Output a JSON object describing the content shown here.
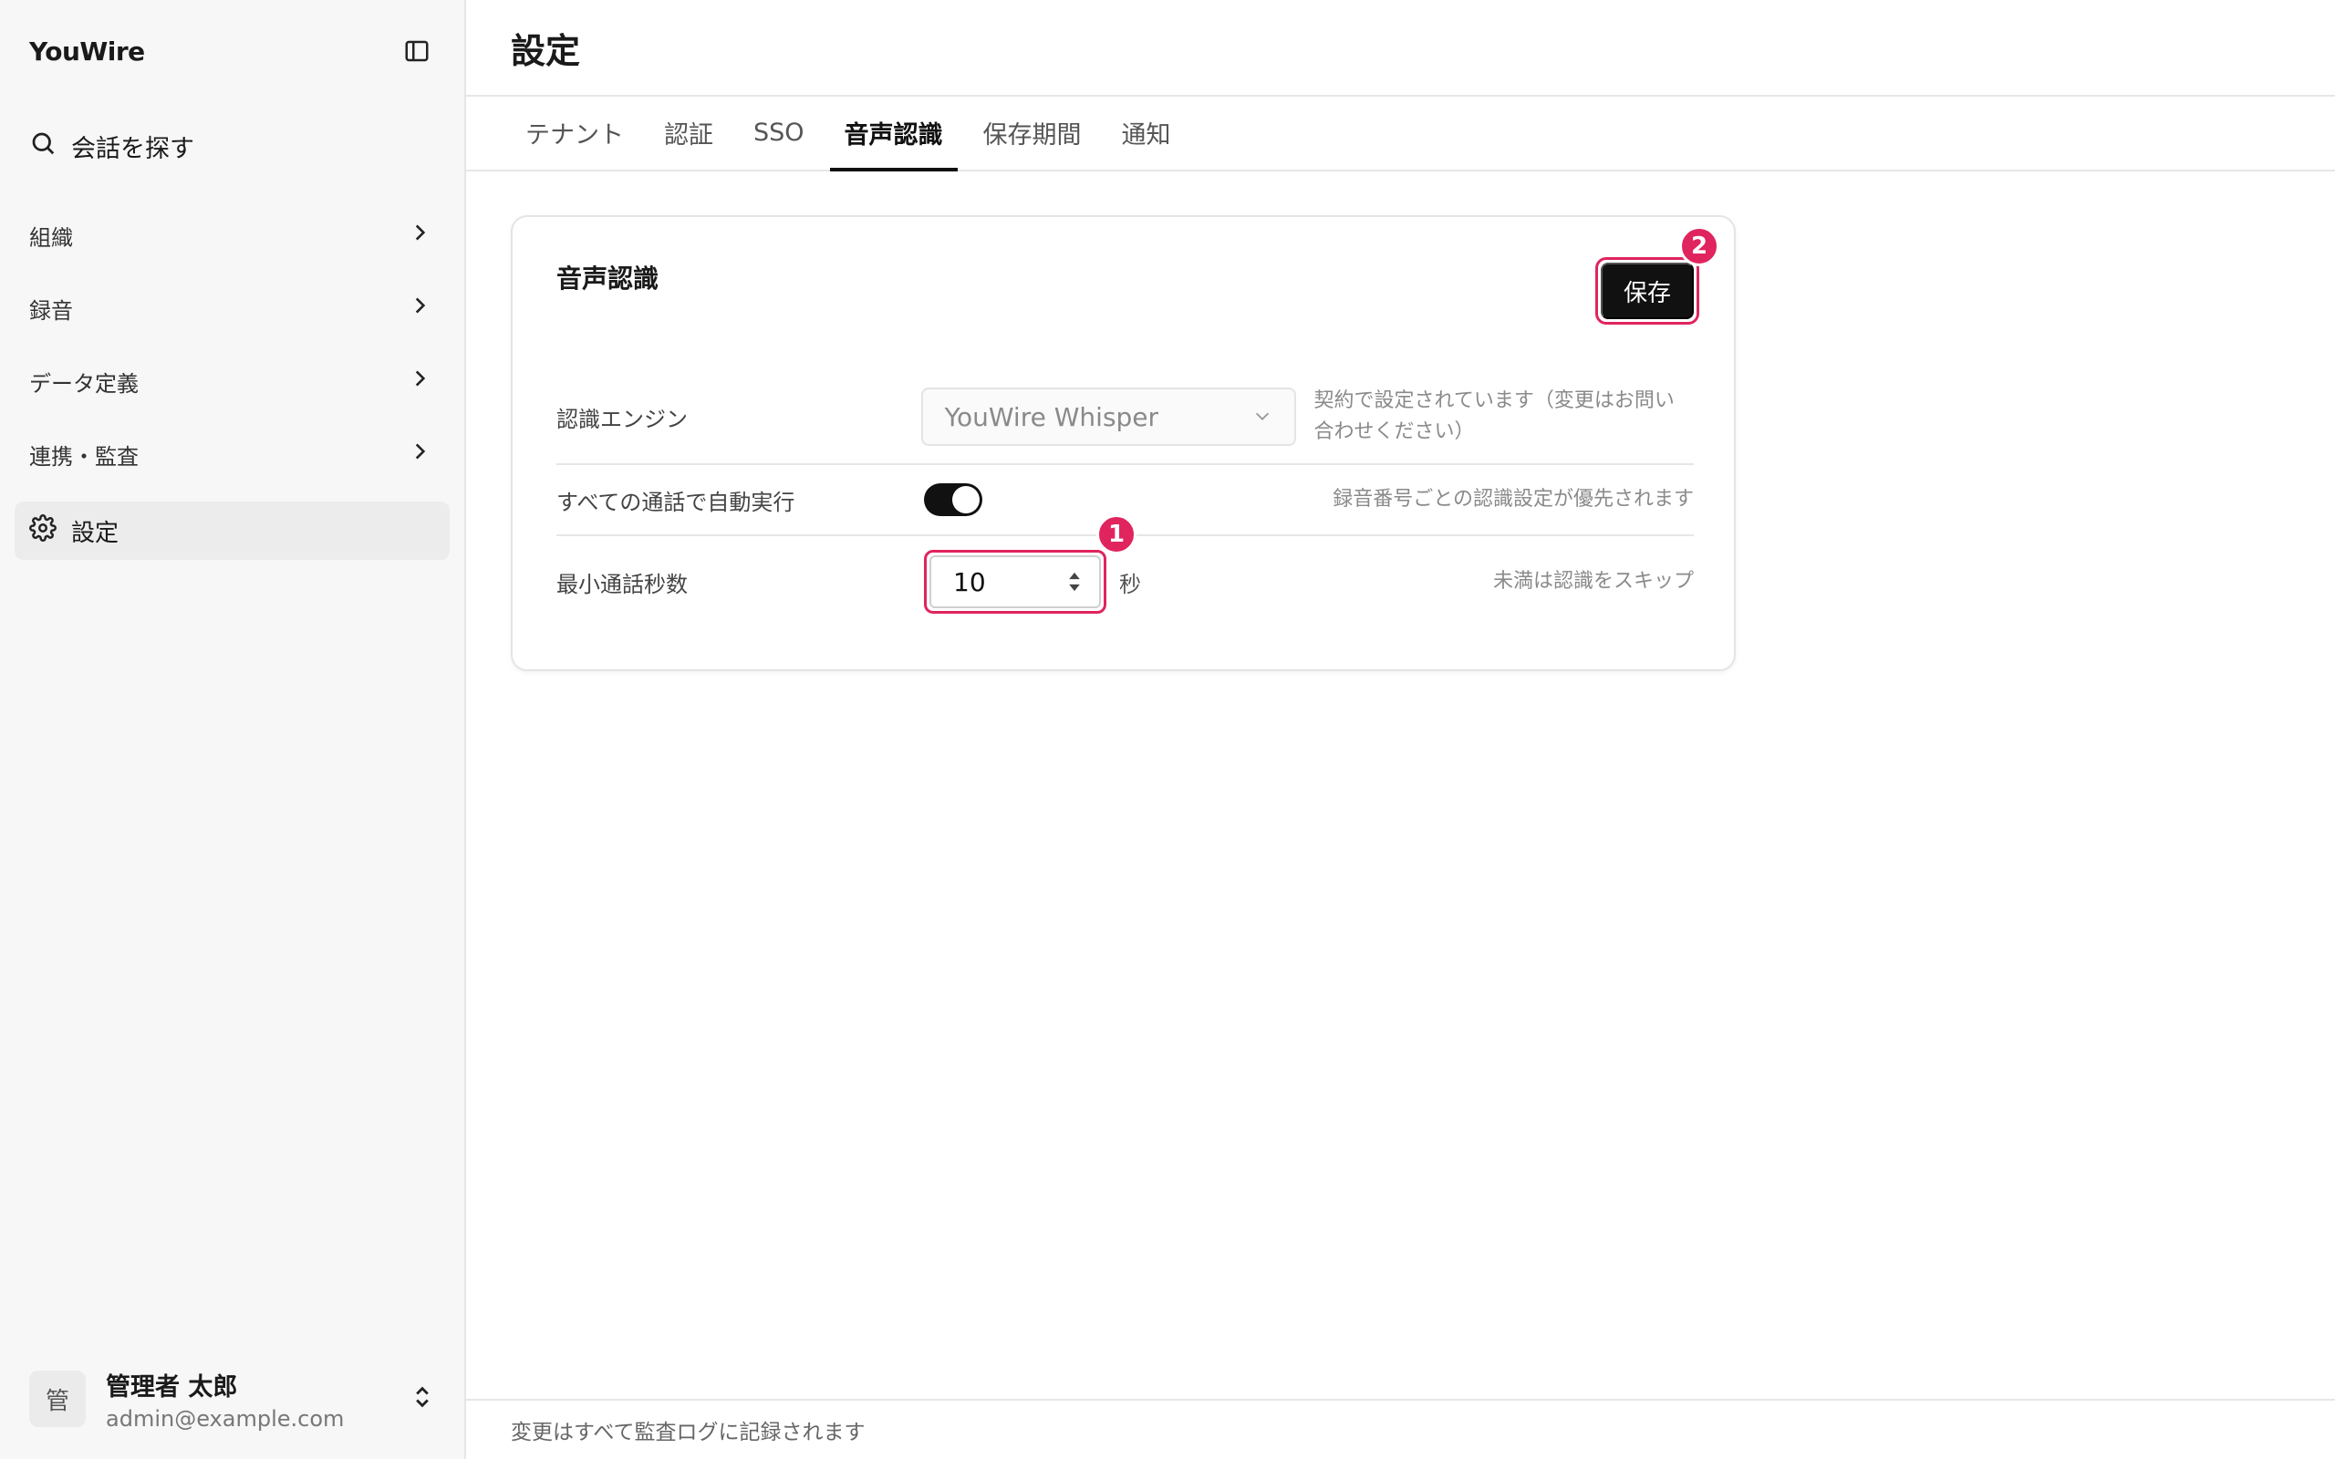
{
  "sidebar": {
    "brand": "YouWire",
    "search_label": "会話を探す",
    "nav_items": [
      {
        "label": "組織"
      },
      {
        "label": "録音"
      },
      {
        "label": "データ定義"
      },
      {
        "label": "連携・監査"
      }
    ],
    "active_item": {
      "label": "設定"
    },
    "user": {
      "avatar_initial": "管",
      "name": "管理者 太郎",
      "email": "admin@example.com"
    }
  },
  "header": {
    "title": "設定"
  },
  "tabs": [
    {
      "label": "テナント",
      "active": false
    },
    {
      "label": "認証",
      "active": false
    },
    {
      "label": "SSO",
      "active": false
    },
    {
      "label": "音声認識",
      "active": true
    },
    {
      "label": "保存期間",
      "active": false
    },
    {
      "label": "通知",
      "active": false
    }
  ],
  "card": {
    "title": "音声認識",
    "save_label": "保存",
    "badges": {
      "input": "1",
      "save": "2"
    },
    "rows": {
      "engine": {
        "label": "認識エンジン",
        "value": "YouWire Whisper",
        "note_line1": "契約で設定されています（変更はお問い",
        "note_line2": "合わせください）"
      },
      "auto_run": {
        "label": "すべての通話で自動実行",
        "enabled": true,
        "note": "録音番号ごとの認識設定が優先されます"
      },
      "min_seconds": {
        "label": "最小通話秒数",
        "value": "10",
        "unit": "秒",
        "note": "未満は認識をスキップ"
      }
    }
  },
  "footer": {
    "text": "変更はすべて監査ログに記録されます"
  },
  "colors": {
    "accent_highlight": "#e0245e",
    "primary_button": "#111111",
    "sidebar_bg": "#f7f7f7"
  }
}
